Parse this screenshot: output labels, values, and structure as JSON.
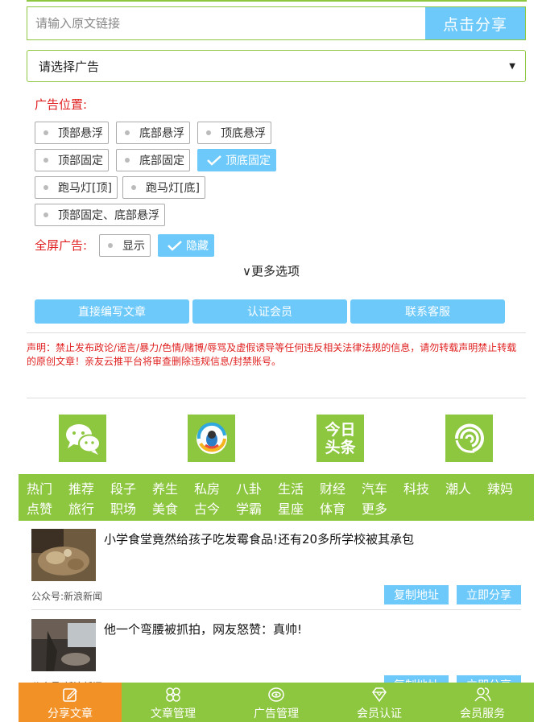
{
  "url_bar": {
    "placeholder": "请输入原文链接",
    "share_label": "点击分享"
  },
  "ad_select": {
    "selected": "请选择广告"
  },
  "ad_position": {
    "label": "广告位置:",
    "options": [
      {
        "label": "顶部悬浮",
        "selected": false
      },
      {
        "label": "底部悬浮",
        "selected": false
      },
      {
        "label": "顶底悬浮",
        "selected": false
      },
      {
        "label": "顶部固定",
        "selected": false
      },
      {
        "label": "底部固定",
        "selected": false
      },
      {
        "label": "顶底固定",
        "selected": true
      },
      {
        "label": "跑马灯[顶]",
        "selected": false
      },
      {
        "label": "跑马灯[底]",
        "selected": false
      },
      {
        "label": "顶部固定、底部悬浮",
        "selected": false
      }
    ]
  },
  "fullscreen_ad": {
    "label": "全屏广告:",
    "options": [
      {
        "label": "显示",
        "selected": false
      },
      {
        "label": "隐藏",
        "selected": true
      }
    ]
  },
  "more_options": "∨更多选项",
  "action_buttons": [
    "直接编写文章",
    "认证会员",
    "联系客服"
  ],
  "notice": "声明：禁止发布政论/谣言/暴力/色情/赌博/辱骂及虚假诱导等任何违反相关法律法规的信息，请勿转载声明禁止转载的原创文章！亲友云推平台将审查删除违规信息/封禁账号。",
  "share_platforms": [
    {
      "name": "wechat-icon"
    },
    {
      "name": "qq-zone-icon"
    },
    {
      "name": "toutiao-icon",
      "text_line1": "今日",
      "text_line2": "头条"
    },
    {
      "name": "swirl-icon"
    }
  ],
  "categories": [
    "热门",
    "推荐",
    "段子",
    "养生",
    "私房",
    "八卦",
    "生活",
    "财经",
    "汽车",
    "科技",
    "潮人",
    "辣妈",
    "点赞",
    "旅行",
    "职场",
    "美食",
    "古今",
    "学霸",
    "星座",
    "体育",
    "更多"
  ],
  "articles": [
    {
      "title": "小学食堂竟然给孩子吃发霉食品!还有20多所学校被其承包",
      "source": "公众号:新浪新闻",
      "copy_label": "复制地址",
      "share_label": "立即分享"
    },
    {
      "title": "他一个弯腰被抓拍，网友怒赞：真帅!",
      "source": "公众号:新浪新闻",
      "copy_label": "复制地址",
      "share_label": "立即分享"
    }
  ],
  "bottom_nav": [
    {
      "label": "分享文章",
      "icon": "edit-icon",
      "active": true
    },
    {
      "label": "文章管理",
      "icon": "flower-grid-icon",
      "active": false
    },
    {
      "label": "广告管理",
      "icon": "eye-icon",
      "active": false
    },
    {
      "label": "会员认证",
      "icon": "diamond-icon",
      "active": false
    },
    {
      "label": "会员服务",
      "icon": "users-icon",
      "active": false
    }
  ],
  "colors": {
    "green": "#8dc63f",
    "blue": "#6cc9fa",
    "orange": "#f29125",
    "red": "#e02020"
  }
}
